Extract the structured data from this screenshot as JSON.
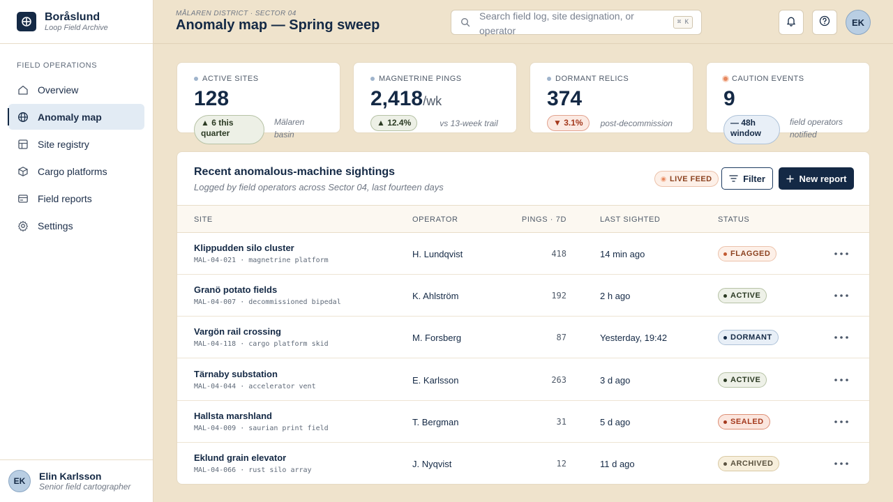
{
  "brand": {
    "name": "Boråslund",
    "subtitle": "Loop Field Archive"
  },
  "sidebar": {
    "section_label": "FIELD OPERATIONS",
    "items": [
      {
        "label": "Overview",
        "icon": "home-icon",
        "active": false
      },
      {
        "label": "Anomaly map",
        "icon": "globe-icon",
        "active": true
      },
      {
        "label": "Site registry",
        "icon": "grid-icon",
        "active": false
      },
      {
        "label": "Cargo platforms",
        "icon": "box-icon",
        "active": false
      },
      {
        "label": "Field reports",
        "icon": "card-icon",
        "active": false
      },
      {
        "label": "Settings",
        "icon": "gear-icon",
        "active": false
      }
    ]
  },
  "user": {
    "initials": "EK",
    "name": "Elin Karlsson",
    "role": "Senior field cartographer"
  },
  "header": {
    "eyebrow": "MÅLAREN DISTRICT · SECTOR 04",
    "title": "Anomaly map — Spring sweep",
    "search_placeholder": "Search field log, site designation, or operator",
    "search_value": "",
    "shortcut": "⌘ K",
    "avatar_initials": "EK"
  },
  "stats": [
    {
      "label": "ACTIVE SITES",
      "value": "128",
      "unit": "",
      "delta": "▲ 6 this quarter",
      "note": "Mälaren basin",
      "dot": "#9fb4cc",
      "trend": "up"
    },
    {
      "label": "MAGNETRINE PINGS",
      "value": "2,418",
      "unit": "/wk",
      "delta": "▲ 12.4%",
      "note": "vs 13-week trail",
      "dot": "#9fb4cc",
      "trend": "up"
    },
    {
      "label": "DORMANT RELICS",
      "value": "374",
      "unit": "",
      "delta": "▼ 3.1%",
      "note": "post-decommission",
      "dot": "#9fb4cc",
      "trend": "down"
    },
    {
      "label": "CAUTION EVENTS",
      "value": "9",
      "unit": "",
      "delta": "— 48h window",
      "note": "field operators notified",
      "dot": "#e6885f",
      "trend": "flat"
    }
  ],
  "table": {
    "title": "Recent anomalous-machine sightings",
    "subtitle": "Logged by field operators across Sector 04, last fourteen days",
    "live_label": "LIVE FEED",
    "filter_label": "Filter",
    "new_label": "New report",
    "columns": [
      "SITE",
      "OPERATOR",
      "PINGS · 7D",
      "LAST SIGHTED",
      "STATUS"
    ],
    "rows": [
      {
        "site": "Klippudden silo cluster",
        "code": "MAL-04-021 · magnetrine platform",
        "operator": "H. Lundqvist",
        "pings": "418",
        "sighted": "14 min ago",
        "status": "FLAGGED",
        "kind": "flagged"
      },
      {
        "site": "Granö potato fields",
        "code": "MAL-04-007 · decommissioned bipedal",
        "operator": "K. Ahlström",
        "pings": "192",
        "sighted": "2 h ago",
        "status": "ACTIVE",
        "kind": "active"
      },
      {
        "site": "Vargön rail crossing",
        "code": "MAL-04-118 · cargo platform skid",
        "operator": "M. Forsberg",
        "pings": "87",
        "sighted": "Yesterday, 19:42",
        "status": "DORMANT",
        "kind": "dormant"
      },
      {
        "site": "Tärnaby substation",
        "code": "MAL-04-044 · accelerator vent",
        "operator": "E. Karlsson",
        "pings": "263",
        "sighted": "3 d ago",
        "status": "ACTIVE",
        "kind": "active"
      },
      {
        "site": "Hallsta marshland",
        "code": "MAL-04-009 · saurian print field",
        "operator": "T. Bergman",
        "pings": "31",
        "sighted": "5 d ago",
        "status": "SEALED",
        "kind": "sealed"
      },
      {
        "site": "Eklund grain elevator",
        "code": "MAL-04-066 · rust silo array",
        "operator": "J. Nyqvist",
        "pings": "12",
        "sighted": "11 d ago",
        "status": "ARCHIVED",
        "kind": "archived"
      }
    ]
  }
}
